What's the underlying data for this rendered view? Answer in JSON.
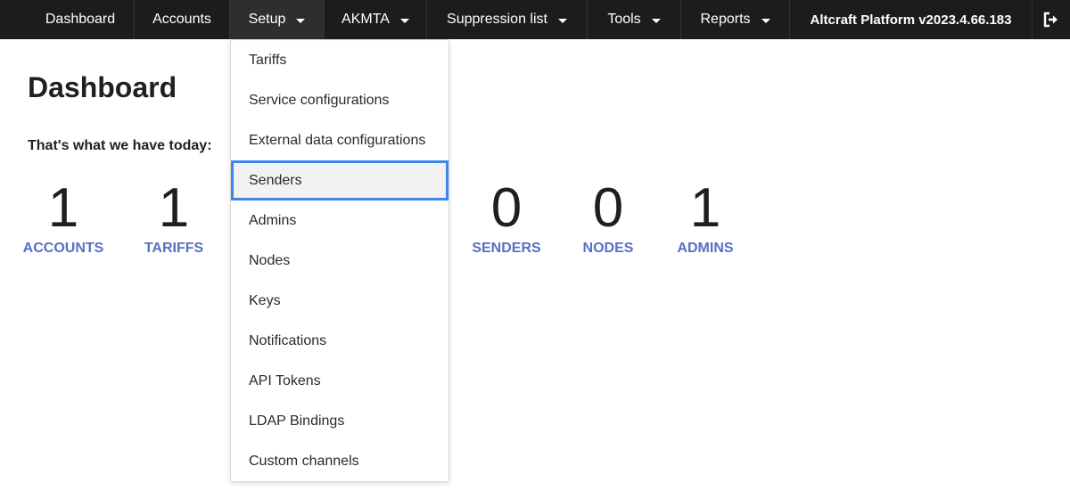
{
  "topnav": {
    "items": [
      {
        "label": "Dashboard"
      },
      {
        "label": "Accounts"
      },
      {
        "label": "Setup"
      },
      {
        "label": "AKMTA"
      },
      {
        "label": "Suppression list"
      },
      {
        "label": "Tools"
      },
      {
        "label": "Reports"
      }
    ],
    "version": "Altcraft Platform v2023.4.66.183",
    "logout_icon": "logout-icon"
  },
  "main": {
    "title": "Dashboard",
    "subtitle": "That's what we have today:",
    "stats": [
      {
        "value": "1",
        "label": "ACCOUNTS"
      },
      {
        "value": "1",
        "label": "TARIFFS"
      },
      {
        "value": "0",
        "label": "SENDERS"
      },
      {
        "value": "0",
        "label": "NODES"
      },
      {
        "value": "1",
        "label": "ADMINS"
      }
    ]
  },
  "setup_menu": {
    "items": [
      {
        "label": "Tariffs"
      },
      {
        "label": "Service configurations"
      },
      {
        "label": "External data configurations"
      },
      {
        "label": "Senders"
      },
      {
        "label": "Admins"
      },
      {
        "label": "Nodes"
      },
      {
        "label": "Keys"
      },
      {
        "label": "Notifications"
      },
      {
        "label": "API Tokens"
      },
      {
        "label": "LDAP Bindings"
      },
      {
        "label": "Custom channels"
      }
    ],
    "highlighted": "Senders"
  },
  "colors": {
    "nav_bg": "#1c1c1c",
    "stat_label": "#5a6ec4",
    "highlight_border": "#3b86ef"
  }
}
